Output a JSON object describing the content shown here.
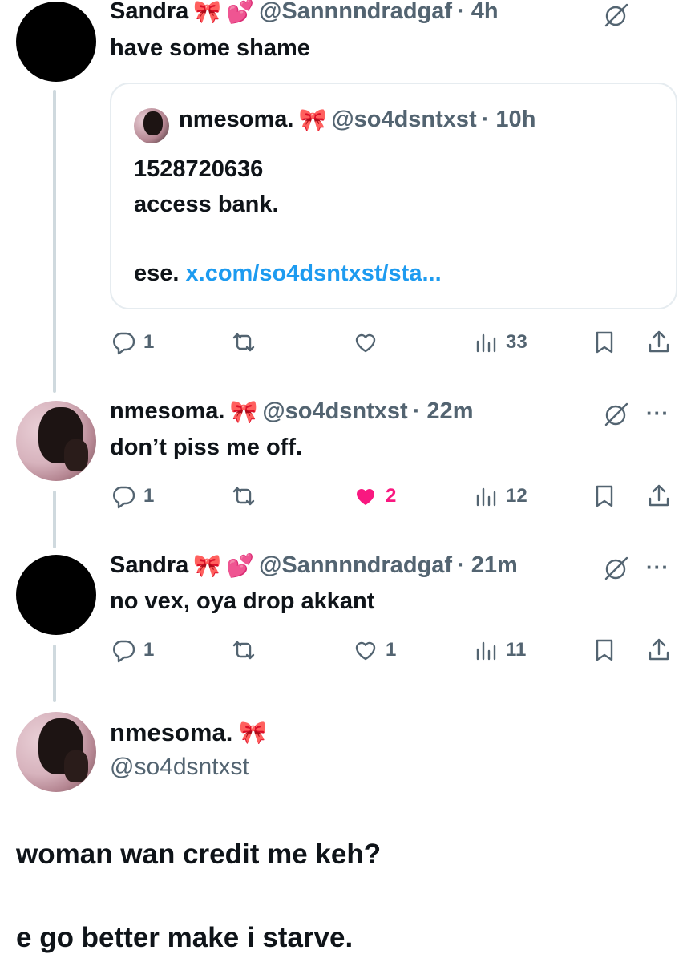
{
  "tweets": [
    {
      "name": "Sandra",
      "emojis": [
        "🎀",
        "💕"
      ],
      "handle": "@Sannnndradgaf",
      "time": "· 4h",
      "text": "have some shame",
      "quote": {
        "name": "nmesoma.",
        "emoji": "🎀",
        "handle": "@so4dsntxst",
        "time": "· 10h",
        "line1": "1528720636",
        "line2": "access bank.",
        "line3_prefix": "ese.",
        "line3_link": "x.com/so4dsntxst/sta..."
      },
      "actions": {
        "replies": "1",
        "reposts": "",
        "likes": "",
        "views": "33"
      }
    },
    {
      "name": "nmesoma.",
      "emojis": [
        "🎀"
      ],
      "handle": "@so4dsntxst",
      "time": "· 22m",
      "text": "don’t piss me off.",
      "actions": {
        "replies": "1",
        "reposts": "",
        "likes": "2",
        "views": "12"
      }
    },
    {
      "name": "Sandra",
      "emojis": [
        "🎀",
        "💕"
      ],
      "handle": "@Sannnndradgaf",
      "time": "· 21m",
      "text": "no vex, oya drop akkant",
      "actions": {
        "replies": "1",
        "reposts": "",
        "likes": "1",
        "views": "11"
      }
    }
  ],
  "main_tweet": {
    "name": "nmesoma.",
    "emoji": "🎀",
    "handle": "@so4dsntxst",
    "line1": "woman wan credit me keh?",
    "line2": "e go better make i starve."
  },
  "more_glyph": "···",
  "colors": {
    "like": "#f91880",
    "link": "#1d9bf0",
    "muted": "#536471",
    "thread": "#cfd9de"
  }
}
